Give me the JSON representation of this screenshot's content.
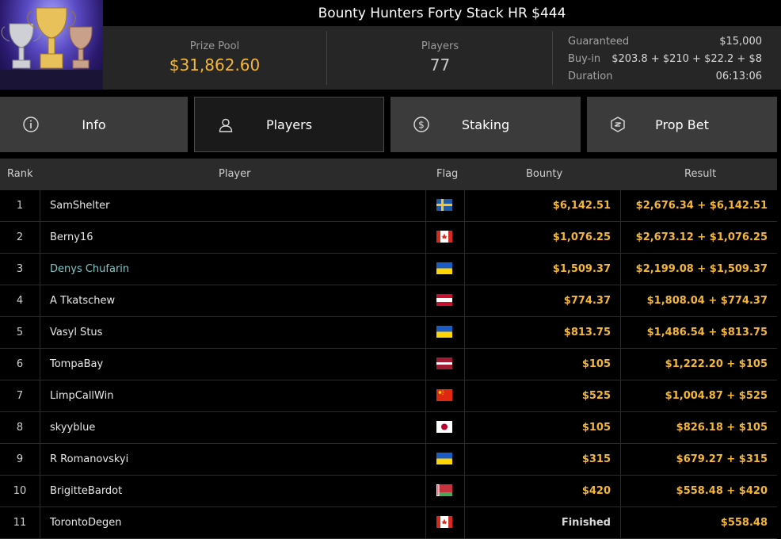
{
  "header": {
    "title": "Bounty Hunters Forty Stack HR $444",
    "prize_pool_label": "Prize Pool",
    "prize_pool_value": "$31,862.60",
    "players_label": "Players",
    "players_value": "77",
    "guaranteed_label": "Guaranteed",
    "guaranteed_value": "$15,000",
    "buyin_label": "Buy-in",
    "buyin_value": "$203.8 + $210 + $22.2 + $8",
    "duration_label": "Duration",
    "duration_value": "06:13:06"
  },
  "logo_icon": "trophies-icon",
  "tabs": [
    {
      "label": "Info",
      "icon": "info-icon"
    },
    {
      "label": "Players",
      "icon": "user-icon"
    },
    {
      "label": "Staking",
      "icon": "dollar-coin-icon"
    },
    {
      "label": "Prop Bet",
      "icon": "prop-bet-icon"
    }
  ],
  "active_tab": "Players",
  "columns": {
    "rank": "Rank",
    "player": "Player",
    "flag": "Flag",
    "bounty": "Bounty",
    "result": "Result"
  },
  "rows": [
    {
      "rank": "1",
      "player": "SamShelter",
      "flag": "sweden",
      "bounty": "$6,142.51",
      "result": "$2,676.34 + $6,142.51"
    },
    {
      "rank": "2",
      "player": "Berny16",
      "flag": "canada",
      "bounty": "$1,076.25",
      "result": "$2,673.12 + $1,076.25"
    },
    {
      "rank": "3",
      "player": "Denys Chufarin",
      "flag": "ukraine",
      "bounty": "$1,509.37",
      "result": "$2,199.08 + $1,509.37",
      "highlight": true
    },
    {
      "rank": "4",
      "player": "A Tkatschew",
      "flag": "austria",
      "bounty": "$774.37",
      "result": "$1,808.04 + $774.37"
    },
    {
      "rank": "5",
      "player": "Vasyl Stus",
      "flag": "ukraine",
      "bounty": "$813.75",
      "result": "$1,486.54 + $813.75"
    },
    {
      "rank": "6",
      "player": "TompaBay",
      "flag": "latvia",
      "bounty": "$105",
      "result": "$1,222.20 + $105"
    },
    {
      "rank": "7",
      "player": "LimpCallWin",
      "flag": "china",
      "bounty": "$525",
      "result": "$1,004.87 + $525"
    },
    {
      "rank": "8",
      "player": "skyyblue",
      "flag": "japan",
      "bounty": "$105",
      "result": "$826.18 + $105"
    },
    {
      "rank": "9",
      "player": "R Romanovskyi",
      "flag": "ukraine",
      "bounty": "$315",
      "result": "$679.27 + $315"
    },
    {
      "rank": "10",
      "player": "BrigitteBardot",
      "flag": "belarus",
      "bounty": "$420",
      "result": "$558.48 + $420"
    },
    {
      "rank": "11",
      "player": "TorontoDegen",
      "flag": "canada",
      "bounty": "Finished",
      "result": "$558.48"
    }
  ],
  "colors": {
    "accent": "#f5b735",
    "highlight_name": "#7ec8c8",
    "panel": "#262626",
    "tab": "#3b3b3b"
  }
}
